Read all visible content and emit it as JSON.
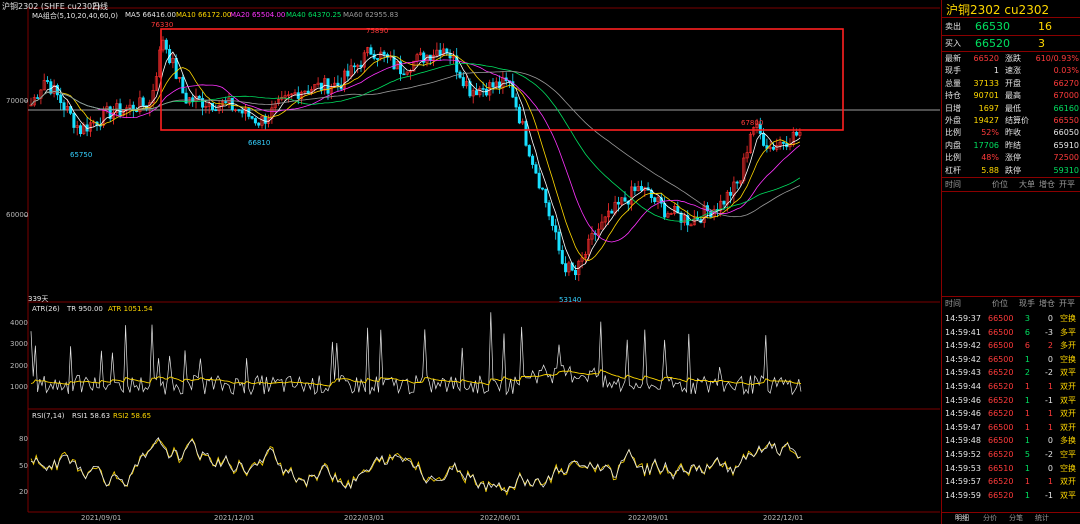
{
  "header": {
    "title": "沪铜2302 (SHFE cu2302)",
    "period": "日线",
    "ma_label": "MA组合(5,10,20,40,60,0)",
    "ma5": "MA5 66416.00",
    "ma10": "MA10 66172.00",
    "ma20": "MA20 65504.00",
    "ma40": "MA40 64370.25",
    "ma60": "MA60 62955.83"
  },
  "main_chart": {
    "y_ticks": [
      "70000",
      "60000"
    ],
    "annotations": {
      "high1": "76330",
      "high2": "75890",
      "low1": "65750",
      "low2": "66810",
      "low3": "53140",
      "high3": "67800"
    },
    "days_label": "339天"
  },
  "atr_panel": {
    "label": "ATR(26)",
    "tr": "TR 950.00",
    "atr": "ATR 1051.54",
    "y_ticks": [
      "4000",
      "3000",
      "2000",
      "1000"
    ]
  },
  "rsi_panel": {
    "label": "RSI(7,14)",
    "rsi1": "RSI1 58.63",
    "rsi2": "RSI2 58.65",
    "y_ticks": [
      "80",
      "50",
      "20"
    ]
  },
  "x_axis": [
    "2021/09/01",
    "2021/12/01",
    "2022/03/01",
    "2022/06/01",
    "2022/09/01",
    "2022/12/01"
  ],
  "quote": {
    "title": "沪铜2302  cu2302",
    "sell_label": "卖出",
    "sell_price": "66530",
    "sell_vol": "16",
    "buy_label": "买入",
    "buy_price": "66520",
    "buy_vol": "3",
    "rows": [
      {
        "l1": "最新",
        "v1": "66520",
        "l2": "涨跌",
        "v2": "610/0.93%"
      },
      {
        "l1": "现手",
        "v1": "1",
        "l2": "速涨",
        "v2": "0.03%"
      },
      {
        "l1": "总量",
        "v1": "37133",
        "l2": "开盘",
        "v2": "66270"
      },
      {
        "l1": "持仓",
        "v1": "90701",
        "l2": "最高",
        "v2": "67000"
      },
      {
        "l1": "日增",
        "v1": "1697",
        "l2": "最低",
        "v2": "66160"
      },
      {
        "l1": "外盘",
        "v1": "19427",
        "l2": "结算价",
        "v2": "66550"
      },
      {
        "l1": "比例",
        "v1": "52%",
        "l2": "昨收",
        "v2": "66050"
      },
      {
        "l1": "内盘",
        "v1": "17706",
        "l2": "昨结",
        "v2": "65910"
      },
      {
        "l1": "比例",
        "v1": "48%",
        "l2": "涨停",
        "v2": "72500"
      },
      {
        "l1": "杠杆",
        "v1": "5.88",
        "l2": "跌停",
        "v2": "59310"
      }
    ],
    "big_header": [
      "时间",
      "价位",
      "大单",
      "增仓",
      "开平"
    ],
    "tick_header": [
      "时间",
      "价位",
      "现手",
      "增仓",
      "开平"
    ],
    "ticks": [
      {
        "time": "14:59:37",
        "price": "66500",
        "vol": "3",
        "chg": "0",
        "type": "空换"
      },
      {
        "time": "14:59:41",
        "price": "66500",
        "vol": "6",
        "chg": "-3",
        "type": "多平"
      },
      {
        "time": "14:59:42",
        "price": "66500",
        "vol": "6",
        "chg": "2",
        "type": "多开"
      },
      {
        "time": "14:59:42",
        "price": "66500",
        "vol": "1",
        "chg": "0",
        "type": "空换"
      },
      {
        "time": "14:59:43",
        "price": "66520",
        "vol": "2",
        "chg": "-2",
        "type": "双平"
      },
      {
        "time": "14:59:44",
        "price": "66520",
        "vol": "1",
        "chg": "1",
        "type": "双开"
      },
      {
        "time": "14:59:46",
        "price": "66520",
        "vol": "1",
        "chg": "-1",
        "type": "双平"
      },
      {
        "time": "14:59:46",
        "price": "66520",
        "vol": "1",
        "chg": "1",
        "type": "双开"
      },
      {
        "time": "14:59:47",
        "price": "66500",
        "vol": "1",
        "chg": "1",
        "type": "双开"
      },
      {
        "time": "14:59:48",
        "price": "66500",
        "vol": "1",
        "chg": "0",
        "type": "多换"
      },
      {
        "time": "14:59:52",
        "price": "66520",
        "vol": "5",
        "chg": "-2",
        "type": "空平"
      },
      {
        "time": "14:59:53",
        "price": "66510",
        "vol": "1",
        "chg": "0",
        "type": "空换"
      },
      {
        "time": "14:59:57",
        "price": "66520",
        "vol": "1",
        "chg": "1",
        "type": "双开"
      },
      {
        "time": "14:59:59",
        "price": "66520",
        "vol": "1",
        "chg": "-1",
        "type": "双平"
      }
    ],
    "footer_tabs": [
      "明细",
      "分价",
      "分笔",
      "统计"
    ]
  }
}
